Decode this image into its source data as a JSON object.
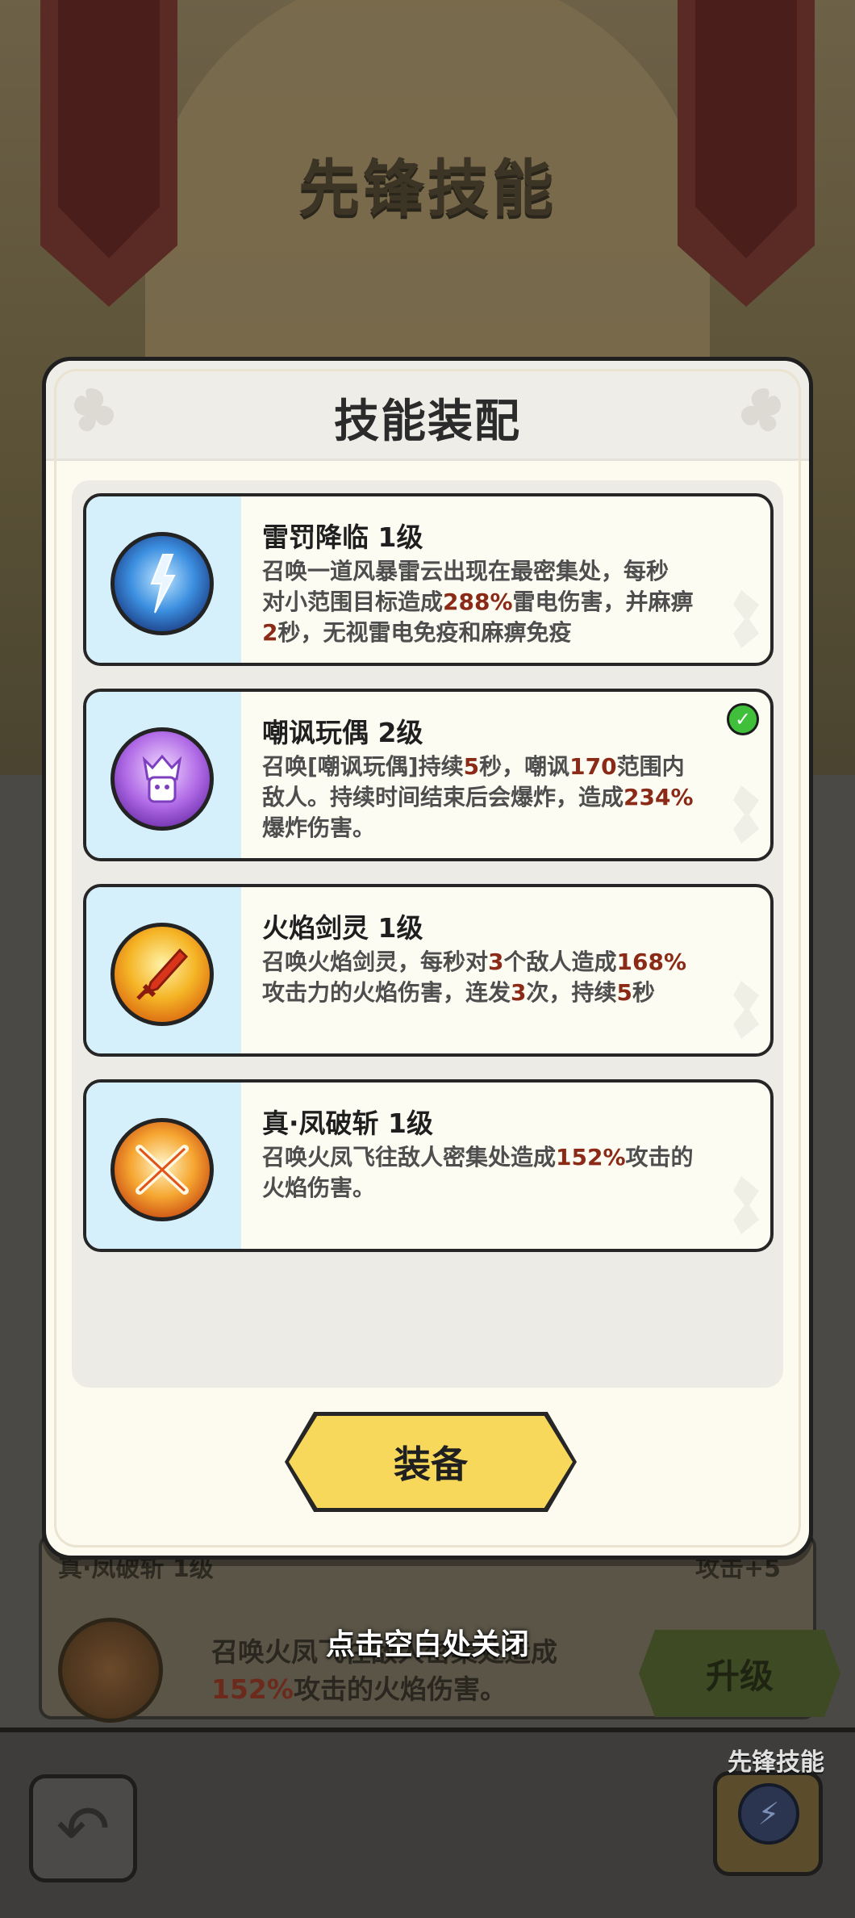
{
  "background": {
    "title": "先锋技能",
    "card": {
      "name": "真·凤破斩 1级",
      "attr": "攻击+5",
      "desc_parts": [
        "召唤火凤飞往敌人密集处造成",
        "152%",
        "攻击的火焰伤害。"
      ],
      "upgrade_label": "升级"
    },
    "close_hint": "点击空白处关闭",
    "bottom_bar": {
      "vanguard_label": "先锋技能",
      "back_icon": "back-arrow-icon",
      "vanguard_icon": "lightning-orb-icon"
    }
  },
  "modal": {
    "title": "技能装配",
    "equip_label": "装备",
    "skills": [
      {
        "name": "雷罚降临 1级",
        "icon": "lightning-storm-icon",
        "equipped": false,
        "desc": [
          "召唤一道风暴雷云出现在最密集处，每秒",
          "对小范围目标造成",
          "288%",
          "雷电伤害，并麻痹",
          "2",
          "秒，无视雷电免疫和麻痹免疫"
        ]
      },
      {
        "name": "嘲讽玩偶 2级",
        "icon": "taunt-doll-icon",
        "equipped": true,
        "desc": [
          "召唤[嘲讽玩偶]持续",
          "5",
          "秒，嘲讽",
          "170",
          "范围内",
          "敌人。持续时间结束后会爆炸，造成",
          "234%",
          "爆炸伤害。"
        ]
      },
      {
        "name": "火焰剑灵 1级",
        "icon": "flame-sword-icon",
        "equipped": false,
        "desc": [
          "召唤火焰剑灵，每秒对",
          "3",
          "个敌人造成",
          "168%",
          "攻击力的火焰伤害，连发",
          "3",
          "次，持续",
          "5",
          "秒"
        ]
      },
      {
        "name": "真·凤破斩 1级",
        "icon": "phoenix-slash-icon",
        "equipped": false,
        "desc": [
          "召唤火凤飞往敌人密集处造成",
          "152%",
          "攻击的",
          "火焰伤害。"
        ]
      }
    ]
  },
  "colors": {
    "highlight": "#8a2a17",
    "equip_button": "#f7d85b",
    "icon_column": "#d6f0fb",
    "check": "#3fbf3a"
  }
}
